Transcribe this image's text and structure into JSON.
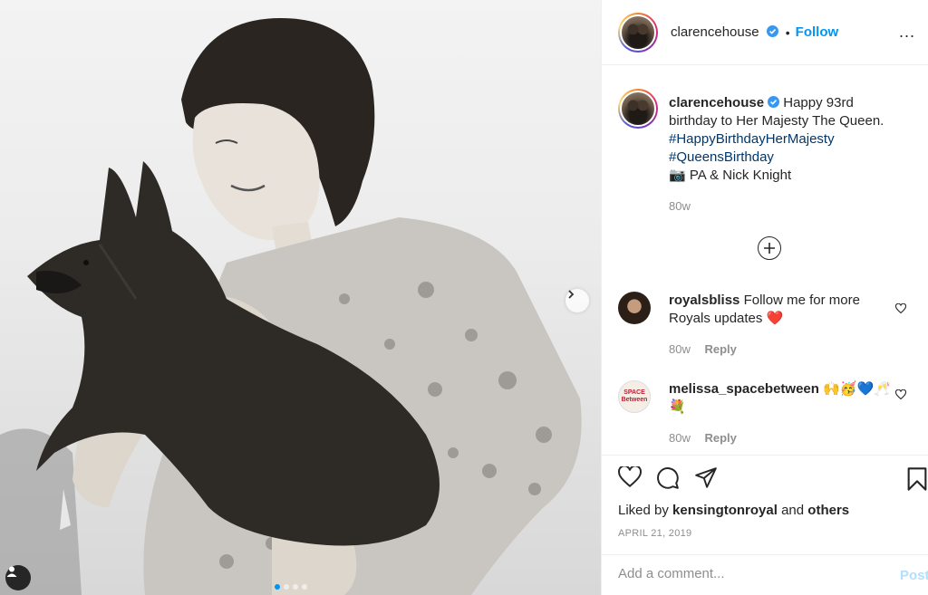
{
  "post": {
    "username": "clarencehouse",
    "follow_label": "Follow",
    "dot": "•",
    "more_label": "...",
    "verified": true
  },
  "caption": {
    "username": "clarencehouse",
    "text": "Happy 93rd birthday to Her Majesty The Queen.",
    "hashtags": [
      "#HappyBirthdayHerMajesty",
      "#QueensBirthday"
    ],
    "credit_icon": "📷",
    "credit": "PA & Nick Knight",
    "age": "80w"
  },
  "comments": [
    {
      "username": "royalsbliss",
      "text": "Follow me for more Royals updates",
      "emoji": "❤️",
      "age": "80w",
      "reply_label": "Reply"
    },
    {
      "username": "melissa_spacebetween",
      "text": "",
      "emoji": "🙌🥳💙🥂💐",
      "age": "80w",
      "reply_label": "Reply",
      "avatar_text": "SPACE Between"
    }
  ],
  "actions": {
    "liked_by_prefix": "Liked by",
    "liked_by_user": "kensingtonroyal",
    "and_label": "and",
    "others_label": "others",
    "date": "APRIL 21, 2019"
  },
  "composer": {
    "placeholder": "Add a comment...",
    "post_label": "Post"
  },
  "carousel": {
    "count": 4,
    "active_index": 0
  },
  "colors": {
    "link": "#0095f6",
    "hashtag": "#00376b",
    "muted": "#8e8e8e",
    "heart": "#ed4956"
  }
}
